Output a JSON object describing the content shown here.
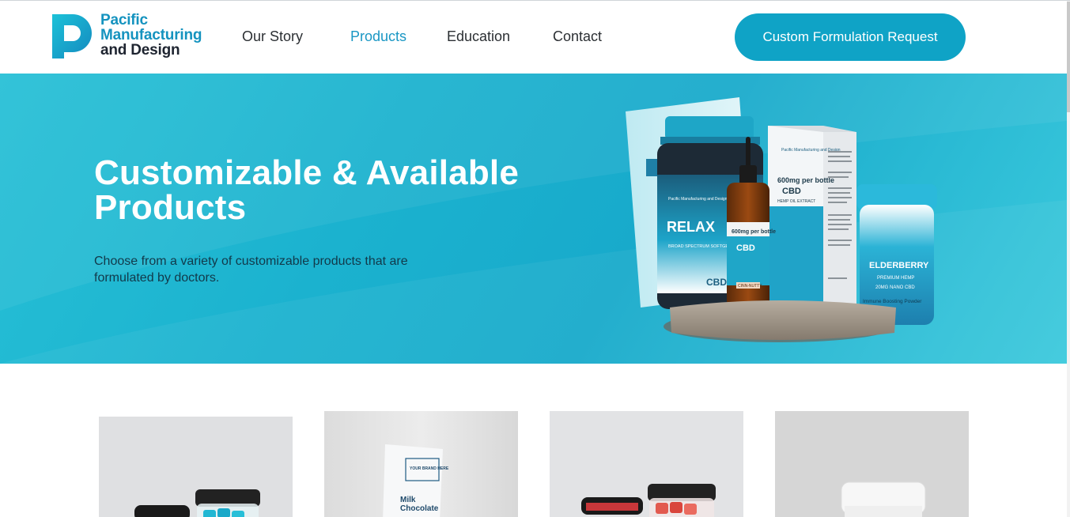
{
  "brand": {
    "line1": "Pacific",
    "line2": "Manufacturing",
    "line3": "and Design"
  },
  "nav": {
    "items": [
      {
        "label": "Our Story"
      },
      {
        "label": "Products",
        "active": true
      },
      {
        "label": "Education"
      },
      {
        "label": "Contact"
      }
    ],
    "cta_label": "Custom Formulation Request"
  },
  "hero": {
    "title_line1": "Customizable & Available",
    "title_line2": "Products",
    "description": "Choose from a variety of customizable products that are formulated by doctors."
  },
  "hero_products": {
    "jar_brand": "Pacific Manufacturing and Design",
    "jar_name": "RELAX",
    "jar_sub": "BROAD SPECTRUM SOFTGELS",
    "jar_tag": "CBD",
    "dropper_amount": "600mg per bottle",
    "dropper_tag": "CBD",
    "dropper_flavor": "CINN-NUTTY",
    "box_brand": "Pacific Manufacturing and Design",
    "box_amount": "600mg per bottle",
    "box_tag": "CBD",
    "box_sub": "HEMP OIL EXTRACT",
    "tub_name": "ELDERBERRY",
    "tub_sub1": "PREMIUM HEMP",
    "tub_sub2": "20MG NANO CBD",
    "tub_sub3": "Immune Boosting Powder"
  },
  "cards": [
    {
      "name": "gummies-blue"
    },
    {
      "name": "milk-chocolate",
      "brand": "YOUR BRAND HERE",
      "label_line1": "Milk",
      "label_line2": "Chocolate"
    },
    {
      "name": "gummies-red"
    },
    {
      "name": "white-tub"
    }
  ],
  "colors": {
    "accent": "#0fa3c6",
    "nav_active": "#1a97c4",
    "hero_bg": "#1bb2cf",
    "hero_text": "#ffffff",
    "hero_desc": "#12394a"
  }
}
